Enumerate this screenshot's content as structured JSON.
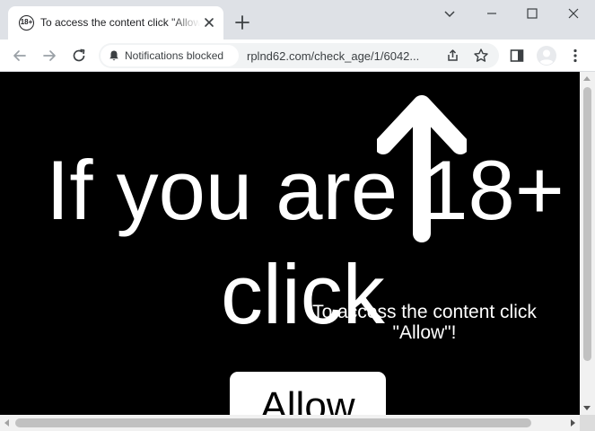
{
  "tab": {
    "favicon_text": "18+",
    "title": "To access the content click \"Allow\"!",
    "favicon_icon": "age-18-icon"
  },
  "toolbar": {
    "site_chip_label": "Notifications blocked",
    "url": "rplnd62.com/check_age/1/6042..."
  },
  "page": {
    "headline_line1": "If you are 18+",
    "headline_line2": "click",
    "overlay_text": "To access the content click \"Allow\"!",
    "allow_button": "Allow"
  },
  "colors": {
    "page_background": "#000000",
    "page_text": "#ffffff",
    "tab_strip": "#dee1e6",
    "omnibox": "#f1f3f4"
  }
}
